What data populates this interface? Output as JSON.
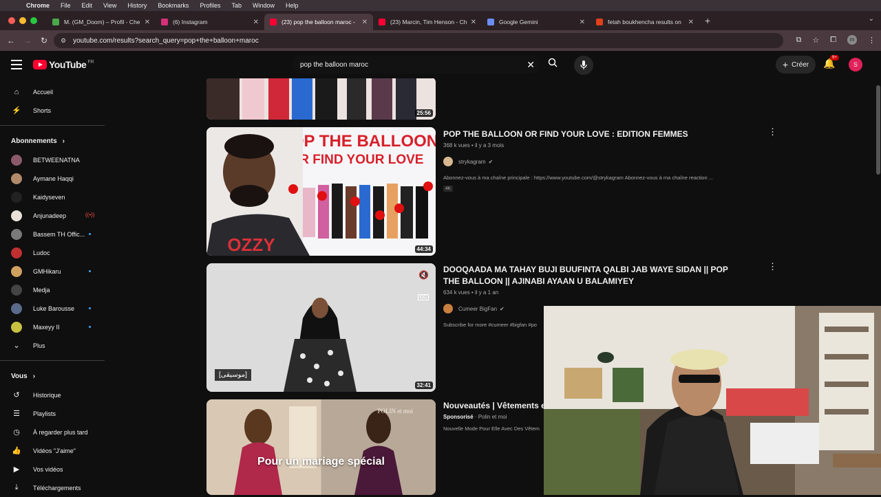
{
  "mac_menu": {
    "app": "Chrome",
    "items": [
      "File",
      "Edit",
      "View",
      "History",
      "Bookmarks",
      "Profiles",
      "Tab",
      "Window",
      "Help"
    ]
  },
  "tabs": [
    {
      "title": "M. (GM_Doom) – Profil - Che",
      "fav_color": "#4aa84a",
      "active": false
    },
    {
      "title": "(6) Instagram",
      "fav_color": "#d6307a",
      "active": false
    },
    {
      "title": "(23) pop the balloon maroc -",
      "fav_color": "#ff0033",
      "active": true
    },
    {
      "title": "(23) Marcin, Tim Henson - Ch",
      "fav_color": "#ff0033",
      "active": false
    },
    {
      "title": "Google Gemini",
      "fav_color": "#6b8ef5",
      "active": false
    },
    {
      "title": "fetah boukhencha results on",
      "fav_color": "#e0401a",
      "active": false
    }
  ],
  "address": {
    "url": "youtube.com/results?search_query=pop+the+balloon+maroc",
    "profile_initial": "m"
  },
  "yt_header": {
    "logo_text": "YouTube",
    "country": "FR",
    "search_value": "pop the balloon maroc",
    "create_label": "Créer",
    "notif_count": "9+",
    "avatar_initial": "S"
  },
  "sidebar": {
    "main": [
      {
        "label": "Accueil",
        "icon": "home-icon",
        "glyph": "⌂"
      },
      {
        "label": "Shorts",
        "icon": "shorts-icon",
        "glyph": "⚡"
      }
    ],
    "subs_heading": "Abonnements",
    "subs": [
      {
        "label": "BETWEENATNA",
        "color": "#8a5a6a",
        "dot": false,
        "live": false
      },
      {
        "label": "Aymane Haqqi",
        "color": "#b08a6a",
        "dot": false,
        "live": false
      },
      {
        "label": "Kaidyseven",
        "color": "#222222",
        "dot": false,
        "live": false
      },
      {
        "label": "Anjunadeep",
        "color": "#e8e2d8",
        "dot": false,
        "live": true
      },
      {
        "label": "Bassem TH Offic...",
        "color": "#7a7a7a",
        "dot": true,
        "live": false
      },
      {
        "label": "Ludoc",
        "color": "#c03030",
        "dot": false,
        "live": false
      },
      {
        "label": "GMHikaru",
        "color": "#d0a060",
        "dot": true,
        "live": false
      },
      {
        "label": "Medja",
        "color": "#444444",
        "dot": false,
        "live": false
      },
      {
        "label": "Luke Barousse",
        "color": "#5a6a8a",
        "dot": true,
        "live": false
      },
      {
        "label": "Maxeyy II",
        "color": "#c8c040",
        "dot": true,
        "live": false
      }
    ],
    "more_label": "Plus",
    "you_heading": "Vous",
    "you": [
      {
        "label": "Historique",
        "icon": "history-icon",
        "glyph": "↺"
      },
      {
        "label": "Playlists",
        "icon": "playlists-icon",
        "glyph": "☰"
      },
      {
        "label": "À regarder plus tard",
        "icon": "watch-later-icon",
        "glyph": "◷"
      },
      {
        "label": "Vidéos \"J'aime\"",
        "icon": "like-icon",
        "glyph": "👍"
      },
      {
        "label": "Vos vidéos",
        "icon": "your-videos-icon",
        "glyph": "▶"
      },
      {
        "label": "Téléchargements",
        "icon": "download-icon",
        "glyph": "⤓"
      }
    ]
  },
  "results": [
    {
      "duration": "25:56"
    },
    {
      "title": "POP THE BALLOON OR FIND YOUR LOVE : EDITION FEMMES",
      "meta": "368 k vues • il y a 3 mois",
      "channel": "strykagram",
      "desc": "Abonnez-vous à ma chaîne principale : https://www.youtube.com/@strykagram Abonnez-vous à ma chaîne reaction ...",
      "badge": "4K",
      "duration": "44:34",
      "thumb_line1": "POP THE BALLOON",
      "thumb_line2": "OR FIND YOUR LOVE",
      "shirt_text": "OZZY"
    },
    {
      "title": "DOOQAADA MA TAHAY BUJI BUUFINTA QALBI JAB WAYE SIDAN || POP THE BALLOON || AJINABI AYAAN U BALAMIYEY",
      "meta": "634 k vues • il y a 1 an",
      "channel": "Cumeer BigFan",
      "desc": "Subscribe for more #cumeer #bigfan #po",
      "duration": "32:41",
      "music_label": "[موسيقى]",
      "cc_label": "CC"
    },
    {
      "title": "Nouveautés | Vêtements ex",
      "sponsored": "Sponsorisé",
      "advertiser": "Polin et moi",
      "desc": "Nouvelle Mode Pour Elle Avec Des Vêtem",
      "overlay": "Pour un mariage spécial",
      "brand_watermark": "POLIN et moi"
    }
  ]
}
